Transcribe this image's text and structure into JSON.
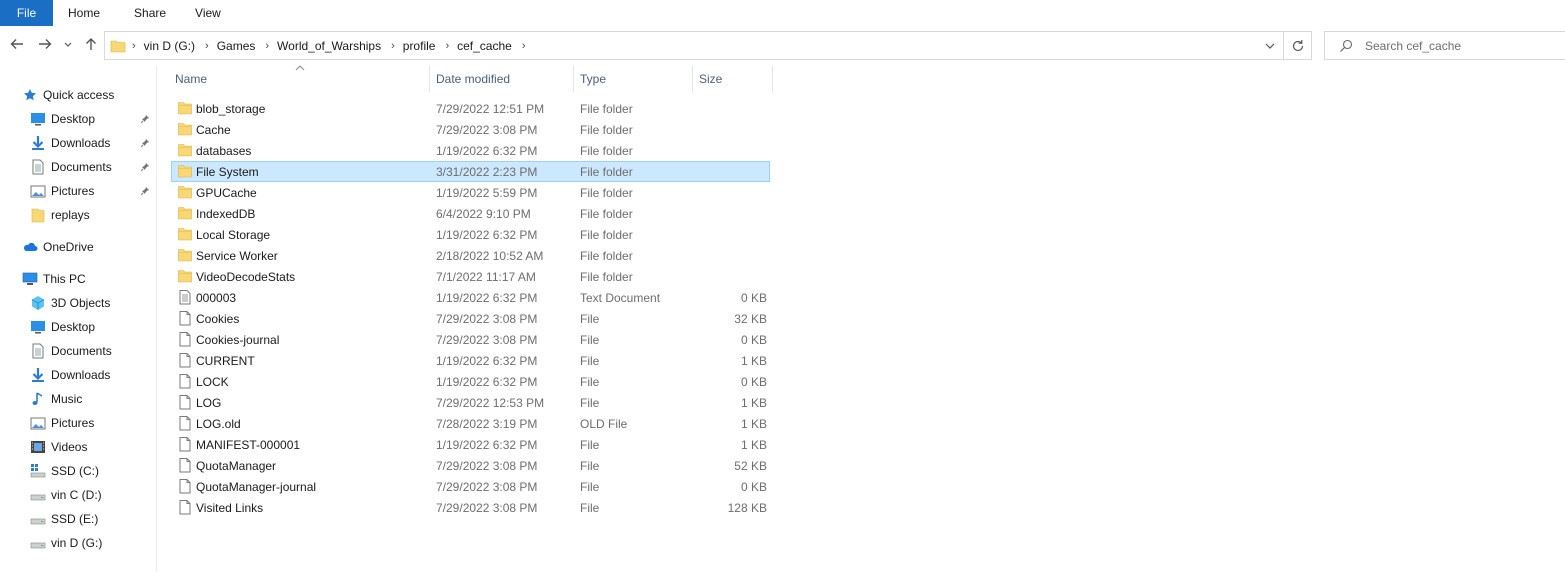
{
  "ribbon": {
    "tabs": [
      "File",
      "Home",
      "Share",
      "View"
    ]
  },
  "address": {
    "breadcrumbs": [
      "vin D (G:)",
      "Games",
      "World_of_Warships",
      "profile",
      "cef_cache"
    ]
  },
  "search": {
    "placeholder": "Search cef_cache"
  },
  "nav": {
    "quick_access": "Quick access",
    "quick_items": [
      {
        "label": "Desktop",
        "icon": "desktop-icon",
        "pinned": true
      },
      {
        "label": "Downloads",
        "icon": "downloads-icon",
        "pinned": true
      },
      {
        "label": "Documents",
        "icon": "documents-icon",
        "pinned": true
      },
      {
        "label": "Pictures",
        "icon": "pictures-icon",
        "pinned": true
      },
      {
        "label": "replays",
        "icon": "folder-icon",
        "pinned": false
      }
    ],
    "onedrive": "OneDrive",
    "this_pc": "This PC",
    "pc_items": [
      {
        "label": "3D Objects",
        "icon": "3d-objects-icon"
      },
      {
        "label": "Desktop",
        "icon": "desktop-icon"
      },
      {
        "label": "Documents",
        "icon": "documents-icon"
      },
      {
        "label": "Downloads",
        "icon": "downloads-icon"
      },
      {
        "label": "Music",
        "icon": "music-icon"
      },
      {
        "label": "Pictures",
        "icon": "pictures-icon"
      },
      {
        "label": "Videos",
        "icon": "videos-icon"
      },
      {
        "label": "SSD (C:)",
        "icon": "system-drive-icon"
      },
      {
        "label": "vin C (D:)",
        "icon": "drive-icon"
      },
      {
        "label": "SSD (E:)",
        "icon": "drive-icon"
      },
      {
        "label": "vin D (G:)",
        "icon": "drive-icon"
      }
    ]
  },
  "columns": {
    "name": "Name",
    "date": "Date modified",
    "type": "Type",
    "size": "Size"
  },
  "files": [
    {
      "name": "blob_storage",
      "date": "7/29/2022 12:51 PM",
      "type": "File folder",
      "size": "",
      "kind": "folder"
    },
    {
      "name": "Cache",
      "date": "7/29/2022 3:08 PM",
      "type": "File folder",
      "size": "",
      "kind": "folder"
    },
    {
      "name": "databases",
      "date": "1/19/2022 6:32 PM",
      "type": "File folder",
      "size": "",
      "kind": "folder"
    },
    {
      "name": "File System",
      "date": "3/31/2022 2:23 PM",
      "type": "File folder",
      "size": "",
      "kind": "folder",
      "selected": true
    },
    {
      "name": "GPUCache",
      "date": "1/19/2022 5:59 PM",
      "type": "File folder",
      "size": "",
      "kind": "folder"
    },
    {
      "name": "IndexedDB",
      "date": "6/4/2022 9:10 PM",
      "type": "File folder",
      "size": "",
      "kind": "folder"
    },
    {
      "name": "Local Storage",
      "date": "1/19/2022 6:32 PM",
      "type": "File folder",
      "size": "",
      "kind": "folder"
    },
    {
      "name": "Service Worker",
      "date": "2/18/2022 10:52 AM",
      "type": "File folder",
      "size": "",
      "kind": "folder"
    },
    {
      "name": "VideoDecodeStats",
      "date": "7/1/2022 11:17 AM",
      "type": "File folder",
      "size": "",
      "kind": "folder"
    },
    {
      "name": "000003",
      "date": "1/19/2022 6:32 PM",
      "type": "Text Document",
      "size": "0 KB",
      "kind": "text"
    },
    {
      "name": "Cookies",
      "date": "7/29/2022 3:08 PM",
      "type": "File",
      "size": "32 KB",
      "kind": "file"
    },
    {
      "name": "Cookies-journal",
      "date": "7/29/2022 3:08 PM",
      "type": "File",
      "size": "0 KB",
      "kind": "file"
    },
    {
      "name": "CURRENT",
      "date": "1/19/2022 6:32 PM",
      "type": "File",
      "size": "1 KB",
      "kind": "file"
    },
    {
      "name": "LOCK",
      "date": "1/19/2022 6:32 PM",
      "type": "File",
      "size": "0 KB",
      "kind": "file"
    },
    {
      "name": "LOG",
      "date": "7/29/2022 12:53 PM",
      "type": "File",
      "size": "1 KB",
      "kind": "file"
    },
    {
      "name": "LOG.old",
      "date": "7/28/2022 3:19 PM",
      "type": "OLD File",
      "size": "1 KB",
      "kind": "file"
    },
    {
      "name": "MANIFEST-000001",
      "date": "1/19/2022 6:32 PM",
      "type": "File",
      "size": "1 KB",
      "kind": "file"
    },
    {
      "name": "QuotaManager",
      "date": "7/29/2022 3:08 PM",
      "type": "File",
      "size": "52 KB",
      "kind": "file"
    },
    {
      "name": "QuotaManager-journal",
      "date": "7/29/2022 3:08 PM",
      "type": "File",
      "size": "0 KB",
      "kind": "file"
    },
    {
      "name": "Visited Links",
      "date": "7/29/2022 3:08 PM",
      "type": "File",
      "size": "128 KB",
      "kind": "file"
    }
  ],
  "colors": {
    "file_tab": "#1a6fc4",
    "selection_bg": "#cce8ff",
    "selection_border": "#99d1ff",
    "folder_yellow": "#f8d775",
    "header_text": "#4c607a"
  }
}
